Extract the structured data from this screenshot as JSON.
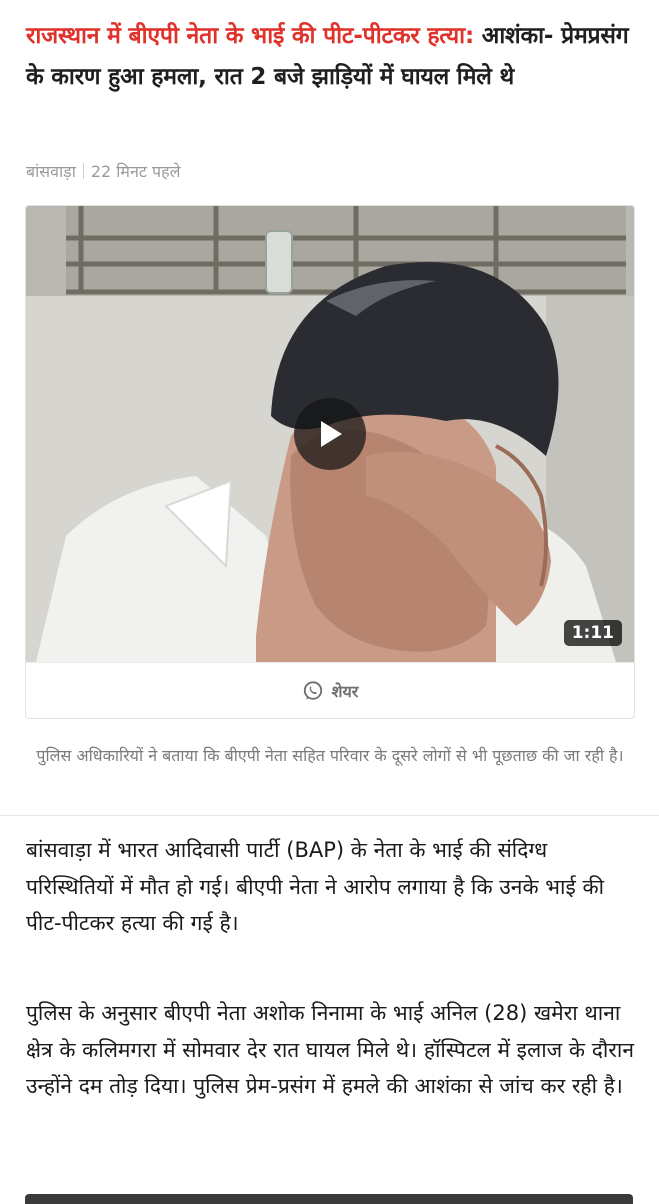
{
  "article": {
    "kicker": "राजस्थान में बीएपी नेता के भाई की पीट-पीटकर हत्या:",
    "subhead": "आशंका- प्रेमप्रसंग के कारण हुआ हमला, रात 2 बजे झाड़ियों में घायल मिले थे",
    "location": "बांसवाड़ा",
    "time_ago": "22 मिनट पहले",
    "video": {
      "duration": "1:11",
      "play_icon": "play-icon"
    },
    "share": {
      "label": "शेयर",
      "icon": "whatsapp-icon"
    },
    "caption": "पुलिस अधिकारियों ने बताया कि बीएपी नेता सहित परिवार के दूसरे लोगों से भी पूछताछ की जा रही है।",
    "paragraphs": [
      "बांसवाड़ा में भारत आदिवासी पार्टी (BAP) के नेता के भाई की संदिग्ध परिस्थितियों में मौत हो गई। बीएपी नेता ने आरोप लगाया है कि उनके भाई की पीट-पीटकर हत्या की गई है।",
      "पुलिस के अनुसार बीएपी नेता अशोक निनामा के भाई अनिल (28) खमेरा थाना क्षेत्र के कलिमगरा में सोमवार देर रात घायल मिले थे। हॉस्पिटल में इलाज के दौरान उन्होंने दम तोड़ दिया। पुलिस प्रेम-प्रसंग में हमले की आशंका से जांच कर रही है।"
    ]
  },
  "colors": {
    "kicker": "#e0322b",
    "text": "#1a1a1a",
    "muted": "#9a9a9a"
  }
}
